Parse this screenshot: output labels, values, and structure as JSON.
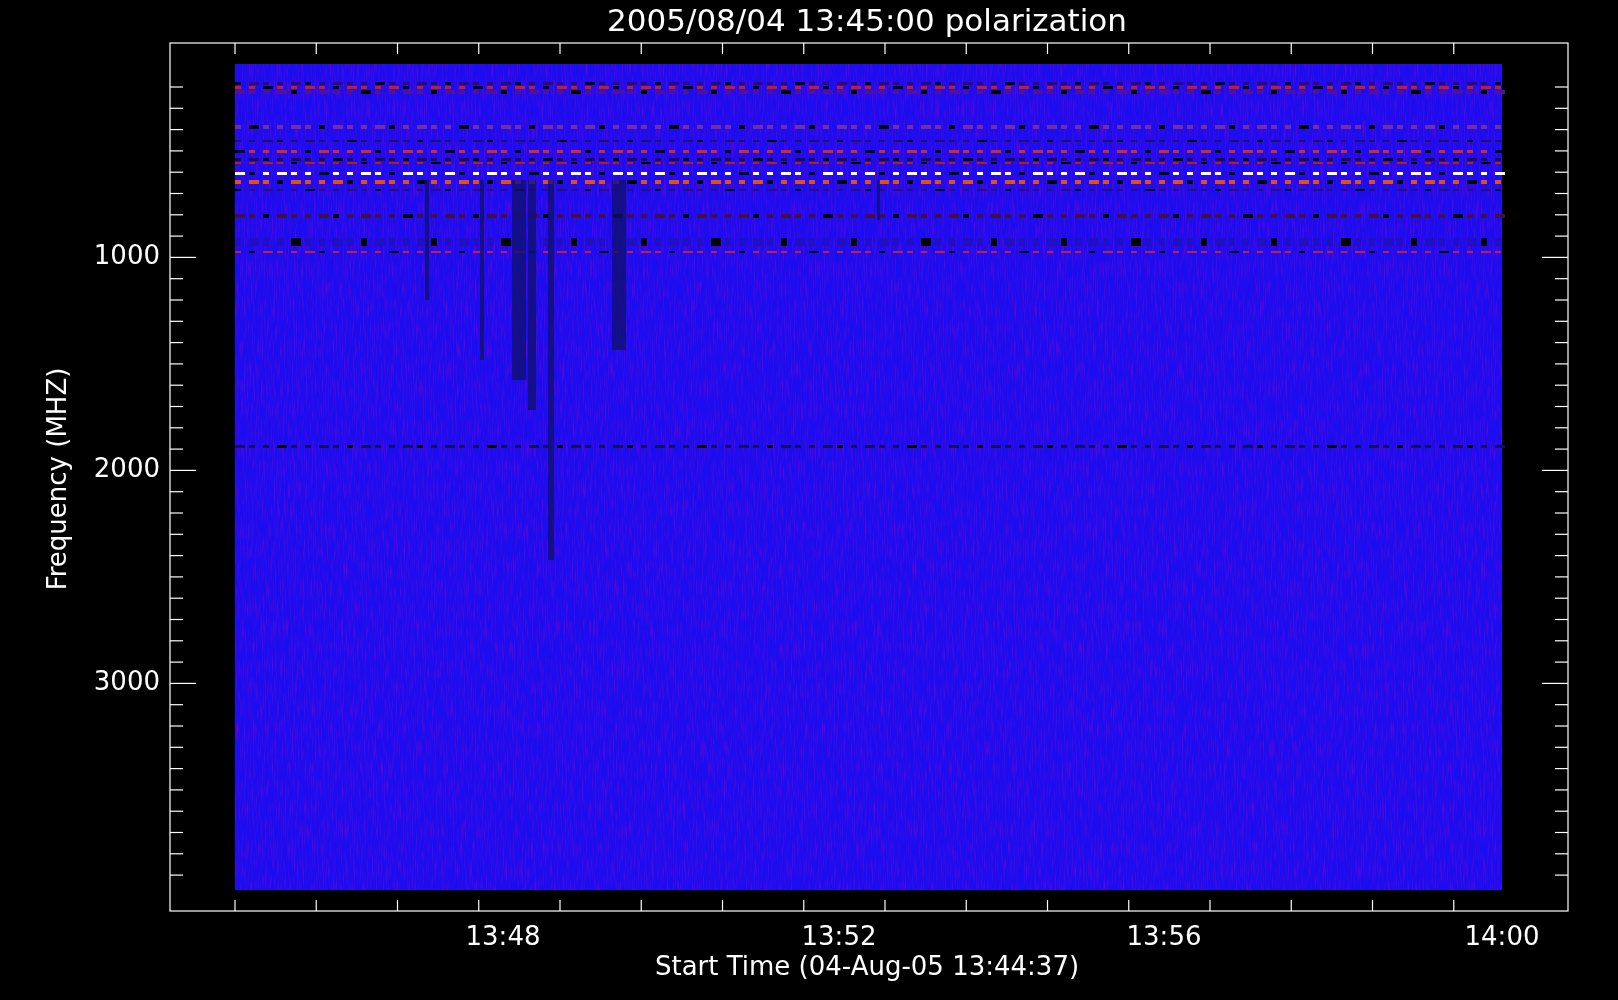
{
  "plot": {
    "title": "2005/08/04 13:45:00 polarization",
    "ylabel": "Frequency (MHZ)",
    "xlabel": "Start Time (04-Aug-05 13:44:37)",
    "yticks": [
      "1000",
      "2000",
      "3000"
    ],
    "xticks": [
      "13:48",
      "13:52",
      "13:56",
      "14:00"
    ]
  }
}
